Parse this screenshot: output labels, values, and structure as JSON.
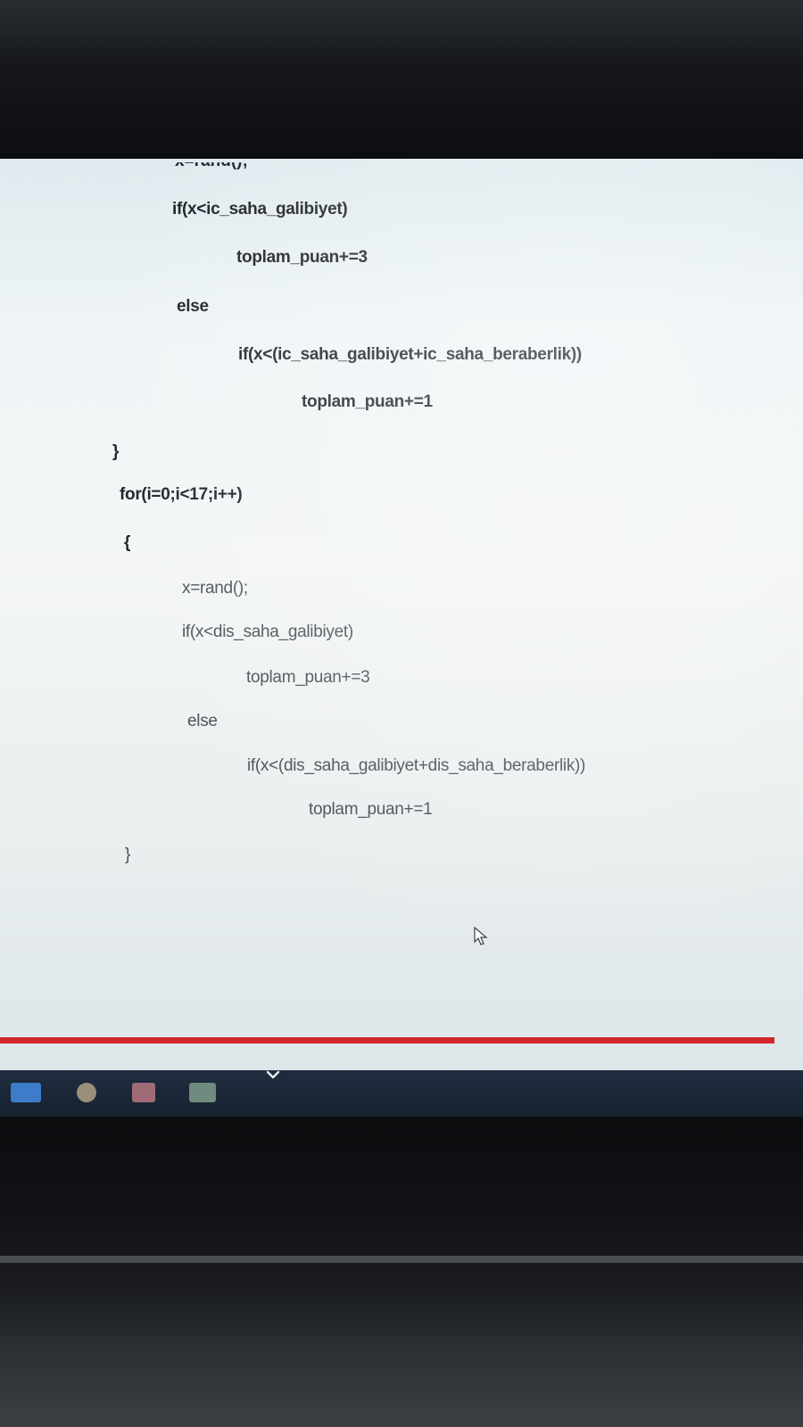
{
  "code": {
    "partial_top": "x=rand();",
    "lines": [
      "if(x<ic_saha_galibiyet)",
      "toplam_puan+=3",
      "else",
      "if(x<(ic_saha_galibiyet+ic_saha_beraberlik))",
      "toplam_puan+=1",
      "}",
      "for(i=0;i<17;i++)",
      "{",
      "x=rand();",
      "if(x<dis_saha_galibiyet)",
      "toplam_puan+=3",
      "else",
      "if(x<(dis_saha_galibiyet+dis_saha_beraberlik))",
      "toplam_puan+=1",
      "}"
    ]
  },
  "taskbar": {
    "icons": [
      "start-icon",
      "chrome-icon",
      "visual-studio-icon",
      "excel-icon"
    ],
    "colors": {
      "start": "#3d7cc9",
      "chrome": "#9a8f7a",
      "visual_studio": "#a06a78",
      "excel": "#6f8a7e"
    }
  },
  "accent_line_color": "#d2262b"
}
